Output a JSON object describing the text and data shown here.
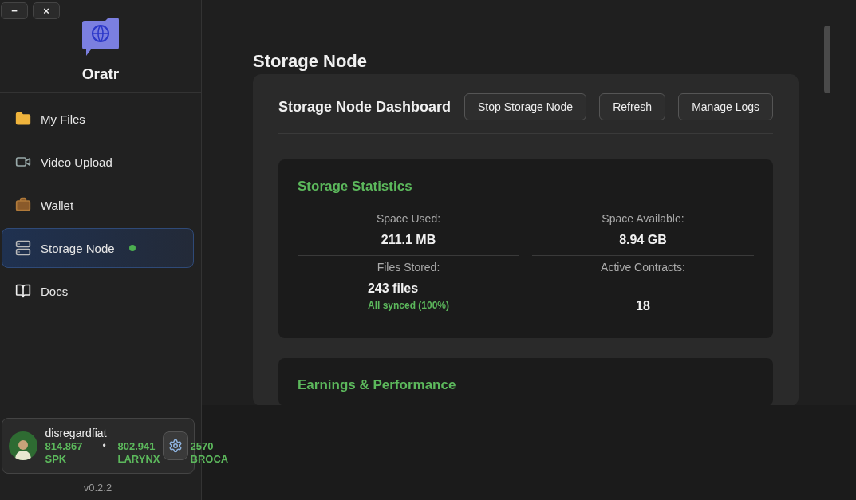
{
  "window_controls": [
    {
      "label": "−"
    },
    {
      "label": "×"
    }
  ],
  "sidebar": {
    "brand": "Oratr",
    "items": [
      {
        "label": "My Files",
        "selected": false,
        "status_dot": false
      },
      {
        "label": "Video Upload",
        "selected": false,
        "status_dot": false
      },
      {
        "label": "Wallet",
        "selected": false,
        "status_dot": false
      },
      {
        "label": "Storage Node",
        "selected": true,
        "status_dot": true
      },
      {
        "label": "Docs",
        "selected": false,
        "status_dot": false
      }
    ],
    "account": {
      "name": "disregardfiat",
      "balances": [
        {
          "amount": "814.867",
          "unit": "SPK"
        },
        {
          "amount": "802.941",
          "unit": "LARYNX"
        },
        {
          "amount": "2570",
          "unit": "BROCA"
        }
      ],
      "separator": "•"
    },
    "version": "v0.2.2"
  },
  "main": {
    "title": "Storage Node",
    "panel": {
      "title": "Storage Node Dashboard",
      "buttons": [
        "Stop Storage Node",
        "Refresh",
        "Manage Logs"
      ],
      "stats_card": {
        "title": "Storage Statistics",
        "stats": [
          {
            "label": "Space Used:",
            "value": "211.1 MB"
          },
          {
            "label": "Space Available:",
            "value": "8.94 GB"
          },
          {
            "label": "Files Stored:",
            "value": "243 files",
            "note": "All synced (100%)"
          },
          {
            "label": "Active Contracts:",
            "value": "18"
          }
        ]
      },
      "next_card": {
        "title": "Earnings & Performance"
      }
    }
  }
}
